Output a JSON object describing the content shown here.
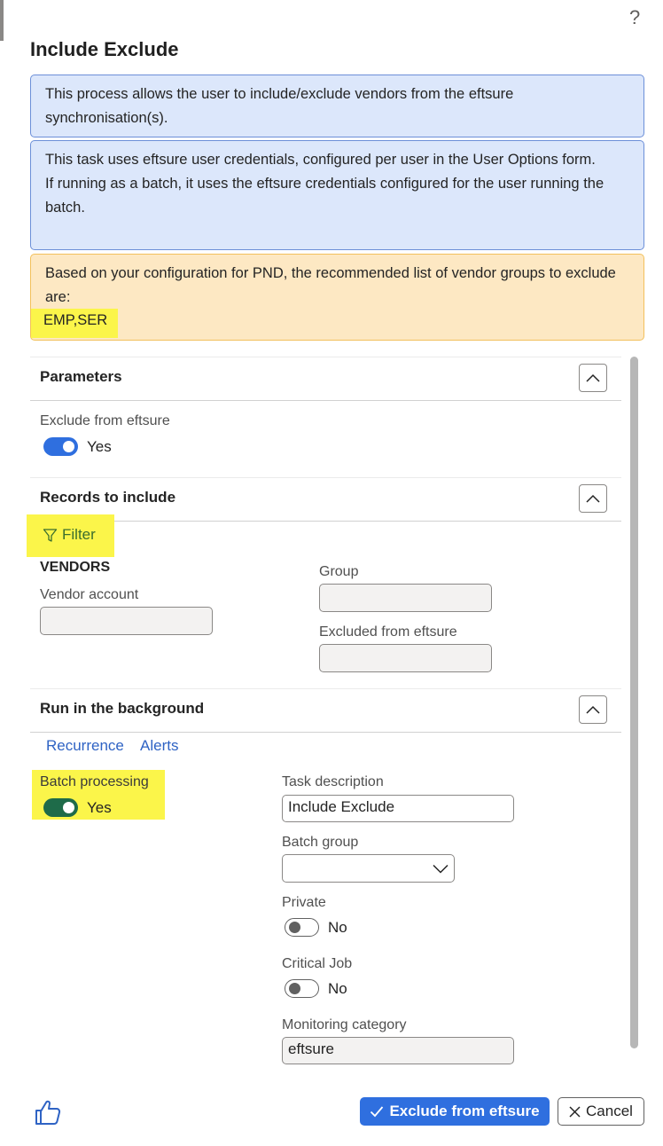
{
  "dialog": {
    "title": "Include Exclude",
    "help_icon": "?"
  },
  "messages": {
    "info1": "This process allows the user to include/exclude vendors from the eftsure synchronisation(s).",
    "info2_line1": "This task uses eftsure user credentials, configured per user in the User Options form.",
    "info2_line2": "If running as a batch, it uses the eftsure credentials configured for the user running the batch.",
    "warning_text": "Based on your configuration for PND, the recommended list of vendor groups to exclude are:",
    "warning_codes": "EMP,SER"
  },
  "parameters": {
    "title": "Parameters",
    "exclude_label": "Exclude from eftsure",
    "exclude_value": "Yes",
    "exclude_on": true
  },
  "records": {
    "title": "Records to include",
    "filter_label": "Filter",
    "table_name": "VENDORS",
    "vendor_account_label": "Vendor account",
    "vendor_account_value": "",
    "group_label": "Group",
    "group_value": "",
    "excluded_label": "Excluded from eftsure",
    "excluded_value": ""
  },
  "background": {
    "title": "Run in the background",
    "recurrence_link": "Recurrence",
    "alerts_link": "Alerts",
    "batch_label": "Batch processing",
    "batch_value": "Yes",
    "batch_on": true,
    "task_desc_label": "Task description",
    "task_desc_value": "Include Exclude",
    "batch_group_label": "Batch group",
    "batch_group_value": "",
    "private_label": "Private",
    "private_value": "No",
    "private_on": false,
    "critical_label": "Critical Job",
    "critical_value": "No",
    "critical_on": false,
    "monitoring_label": "Monitoring category",
    "monitoring_value": "eftsure"
  },
  "footer": {
    "ok_label": "Exclude from eftsure",
    "cancel_label": "Cancel"
  },
  "colors": {
    "accent": "#2f6fdf",
    "highlight": "#fbf54a",
    "info_bg": "#dce7fb",
    "warning_bg": "#fde8c3"
  }
}
